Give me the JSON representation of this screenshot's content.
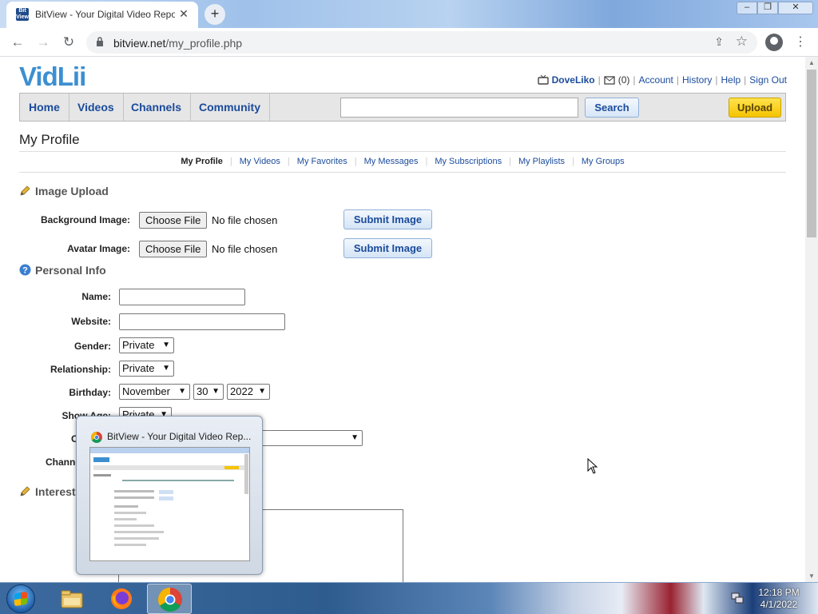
{
  "browser": {
    "tab_title": "BitView - Your Digital Video Repository",
    "favicon_text": "Bit View",
    "url_host": "bitview.net",
    "url_path": "/my_profile.php"
  },
  "site": {
    "logo": "VidLii",
    "user": {
      "username": "DoveLiko",
      "messages": "(0)",
      "links": [
        "Account",
        "History",
        "Help",
        "Sign Out"
      ]
    },
    "nav": [
      "Home",
      "Videos",
      "Channels",
      "Community"
    ],
    "search_button": "Search",
    "search_value": "",
    "upload_button": "Upload"
  },
  "page": {
    "title": "My Profile",
    "subnav": [
      "My Profile",
      "My Videos",
      "My Favorites",
      "My Messages",
      "My Subscriptions",
      "My Playlists",
      "My Groups"
    ],
    "image_upload": {
      "heading": "Image Upload",
      "rows": [
        {
          "label": "Background Image:",
          "file_button": "Choose File",
          "file_status": "No file chosen",
          "submit": "Submit Image"
        },
        {
          "label": "Avatar Image:",
          "file_button": "Choose File",
          "file_status": "No file chosen",
          "submit": "Submit Image"
        }
      ]
    },
    "personal_info": {
      "heading": "Personal Info",
      "name_label": "Name:",
      "name_value": "",
      "website_label": "Website:",
      "website_value": "",
      "gender_label": "Gender:",
      "gender_value": "Private",
      "relationship_label": "Relationship:",
      "relationship_value": "Private",
      "birthday_label": "Birthday:",
      "birthday_month": "November",
      "birthday_day": "30",
      "birthday_year": "2022",
      "show_age_label": "Show Age:",
      "show_age_value": "Private",
      "country_label_partial": "C",
      "channel_label_partial": "Channe"
    },
    "interests": {
      "heading_partial": "Interest"
    }
  },
  "thumbnail_popup": {
    "title": "BitView - Your Digital Video Rep..."
  },
  "taskbar": {
    "time": "12:18 PM",
    "date": "4/1/2022"
  },
  "colors": {
    "link": "#1a4b9c",
    "logo": "#3c8fd1",
    "upload": "#f5c400"
  }
}
